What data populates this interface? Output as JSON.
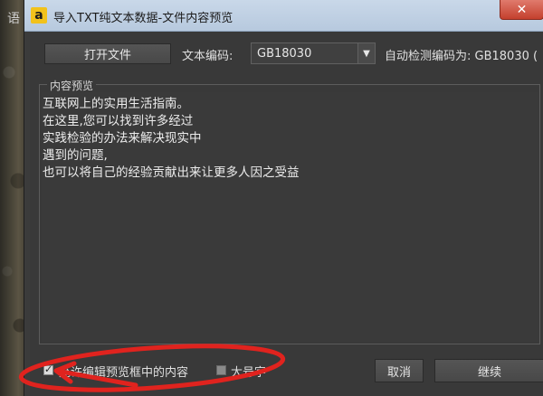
{
  "background": {
    "glyph": "语"
  },
  "window": {
    "title": "导入TXT纯文本数据-文件内容预览",
    "app_icon_letter": "a",
    "close_glyph": "✕"
  },
  "toolbar": {
    "open_file_label": "打开文件",
    "encoding_label": "文本编码:",
    "encoding_value": "GB18030",
    "encoding_arrow": "▼",
    "detected_label": "自动检测编码为: GB18030 ("
  },
  "preview": {
    "group_title": "内容预览",
    "lines": [
      "互联网上的实用生活指南。",
      "在这里,您可以找到许多经过",
      "实践检验的办法来解决现实中",
      "遇到的问题,",
      "也可以将自己的经验贡献出来让更多人因之受益"
    ]
  },
  "footer": {
    "allow_edit_label": "允许编辑预览框中的内容",
    "allow_edit_checked": true,
    "large_font_label": "大号字",
    "large_font_checked": false,
    "cancel_label": "取消",
    "continue_label": "继续"
  },
  "colors": {
    "annotation_red": "#e0231e",
    "titlebar": "#c3d3e6",
    "window_bg": "#393939"
  }
}
